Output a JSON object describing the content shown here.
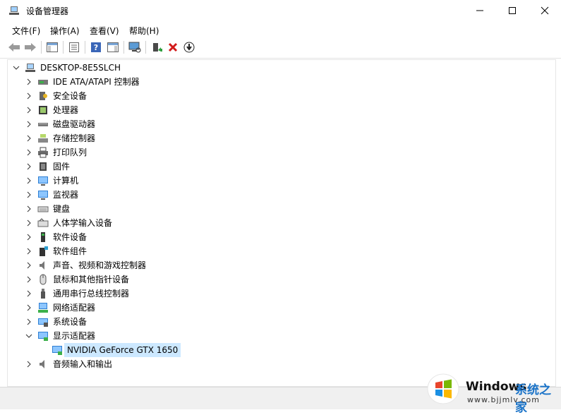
{
  "window": {
    "title": "设备管理器"
  },
  "menu": [
    {
      "label": "文件(F)"
    },
    {
      "label": "操作(A)"
    },
    {
      "label": "查看(V)"
    },
    {
      "label": "帮助(H)"
    }
  ],
  "tree": {
    "root": "DESKTOP-8E5SLCH",
    "items": [
      {
        "label": "IDE ATA/ATAPI 控制器",
        "icon": "ide-controller-icon"
      },
      {
        "label": "安全设备",
        "icon": "security-device-icon"
      },
      {
        "label": "处理器",
        "icon": "processor-icon"
      },
      {
        "label": "磁盘驱动器",
        "icon": "disk-drive-icon"
      },
      {
        "label": "存储控制器",
        "icon": "storage-controller-icon"
      },
      {
        "label": "打印队列",
        "icon": "printer-icon"
      },
      {
        "label": "固件",
        "icon": "firmware-icon"
      },
      {
        "label": "计算机",
        "icon": "computer-icon"
      },
      {
        "label": "监视器",
        "icon": "monitor-icon"
      },
      {
        "label": "键盘",
        "icon": "keyboard-icon"
      },
      {
        "label": "人体学输入设备",
        "icon": "hid-icon"
      },
      {
        "label": "软件设备",
        "icon": "software-device-icon"
      },
      {
        "label": "软件组件",
        "icon": "software-component-icon"
      },
      {
        "label": "声音、视频和游戏控制器",
        "icon": "sound-icon"
      },
      {
        "label": "鼠标和其他指针设备",
        "icon": "mouse-icon"
      },
      {
        "label": "通用串行总线控制器",
        "icon": "usb-icon"
      },
      {
        "label": "网络适配器",
        "icon": "network-adapter-icon"
      },
      {
        "label": "系统设备",
        "icon": "system-device-icon"
      },
      {
        "label": "显示适配器",
        "icon": "display-adapter-icon",
        "expanded": true
      },
      {
        "label": "NVIDIA GeForce GTX 1650",
        "icon": "gpu-icon",
        "child": true,
        "selected": true
      },
      {
        "label": "音频输入和输出",
        "icon": "audio-io-icon"
      }
    ]
  },
  "watermark": {
    "brand": "Windows",
    "site": "系统之家",
    "url": "www.bjjmlv.com"
  },
  "colors": {
    "selection": "#cce8ff",
    "accent": "#1a73c8"
  }
}
